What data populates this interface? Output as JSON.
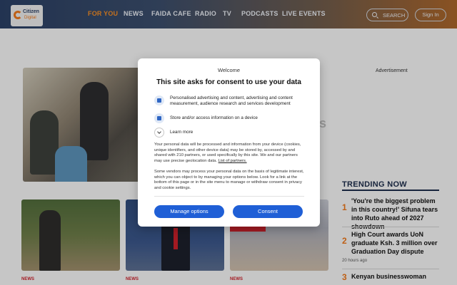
{
  "header": {
    "logo_text_top": "Citizen",
    "logo_text_bottom": "Digital",
    "nav": [
      {
        "label": "FOR YOU",
        "active": true
      },
      {
        "label": "NEWS",
        "active": false
      },
      {
        "label": "FAIDA CAFE",
        "active": false
      },
      {
        "label": "RADIO",
        "active": false
      },
      {
        "label": "TV",
        "active": false
      },
      {
        "label": "PODCASTS",
        "active": false
      },
      {
        "label": "LIVE EVENTS",
        "active": false
      }
    ],
    "search_label": "SEARCH",
    "signin_label": "Sign In"
  },
  "main": {
    "hero_title_fragment": "s",
    "advertisement_label": "Advertisement",
    "cards": [
      {
        "tag": "NEWS"
      },
      {
        "tag": "NEWS"
      },
      {
        "tag": "NEWS"
      }
    ]
  },
  "trending": {
    "title": "TRENDING NOW",
    "items": [
      {
        "num": "1",
        "text": "'You're the biggest problem in this country!' Sifuna tears into Ruto ahead of 2027 showdown",
        "time": ""
      },
      {
        "num": "2",
        "text": "High Court awards UoN graduate Ksh. 3 million over Graduation Day dispute",
        "time": "20 hours ago"
      },
      {
        "num": "3",
        "text": "Kenyan businesswoman",
        "time": ""
      }
    ]
  },
  "consent": {
    "welcome": "Welcome",
    "title": "This site asks for consent to use your data",
    "purposes": [
      {
        "icon": "person-icon",
        "text": "Personalised advertising and content, advertising and content measurement, audience research and services development"
      },
      {
        "icon": "device-icon",
        "text": "Store and/or access information on a device"
      }
    ],
    "learn_more": "Learn more",
    "body1": "Your personal data will be processed and information from your device (cookies, unique identifiers, and other device data) may be stored by, accessed by and shared with 210 partners, or used specifically by this site. We and our partners may use precise geolocation data.",
    "partners_link": "List of partners.",
    "body2": "Some vendors may process your personal data on the basis of legitimate interest, which you can object to by managing your options below. Look for a link at the bottom of this page or in the site menu to manage or withdraw consent in privacy and cookie settings.",
    "manage_label": "Manage options",
    "consent_label": "Consent",
    "accent": "#1f5fd6"
  }
}
